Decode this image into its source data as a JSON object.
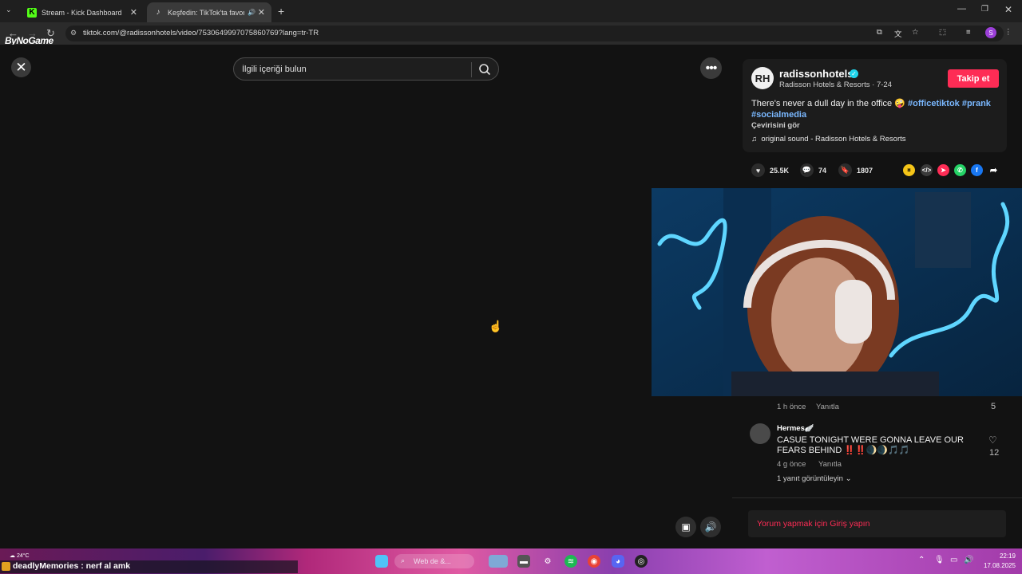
{
  "browser": {
    "tabs": [
      {
        "label": "Stream - Kick Dashboard",
        "icon": "kick-icon",
        "active": false
      },
      {
        "label": "Keşfedin: TikTok'ta favori vi",
        "icon": "tiktok-icon",
        "active": true
      }
    ],
    "url": "tiktok.com/@radissonhotels/video/7530649997075860769?lang=tr-TR"
  },
  "stream_logo": "ByNoGame",
  "search": {
    "placeholder": "İlgili içeriği bulun"
  },
  "post": {
    "avatar_initials": "RH",
    "username": "radissonhotels",
    "subline": "Radisson Hotels & Resorts · 7-24",
    "follow_label": "Takip et",
    "description_text": "There's never a dull day in the office 🤪 ",
    "tags": [
      "#officetiktok",
      "#prank",
      "#socialmedia"
    ],
    "translate_label": "Çevirisini gör",
    "sound": "original sound - Radisson Hotels & Resorts",
    "likes": "25.5K",
    "comments": "74",
    "saves": "1807"
  },
  "comments": [
    {
      "time": "1 h önce",
      "reply": "Yanıtla",
      "likes": "5"
    },
    {
      "author": "Hermes🪽",
      "text": "CASUE TONIGHT WERE GONNA LEAVE OUR FEARS BEHIND ‼️‼️🌒🌒🎵🎵",
      "time": "4 g önce",
      "reply": "Yanıtla",
      "likes": "12",
      "more": "1 yanıt görüntüleyin"
    }
  ],
  "login_prompt": "Yorum yapmak için Giriş yapın",
  "taskbar": {
    "chat_message": "deadlyMemories : nerf al amk",
    "weather": "24°C",
    "search_placeholder": "Web de &...",
    "time": "22:19",
    "date": "17.08.2025"
  },
  "colors": {
    "accent": "#fe2c55",
    "tag": "#7ab8ff",
    "verified": "#20d5ec"
  }
}
